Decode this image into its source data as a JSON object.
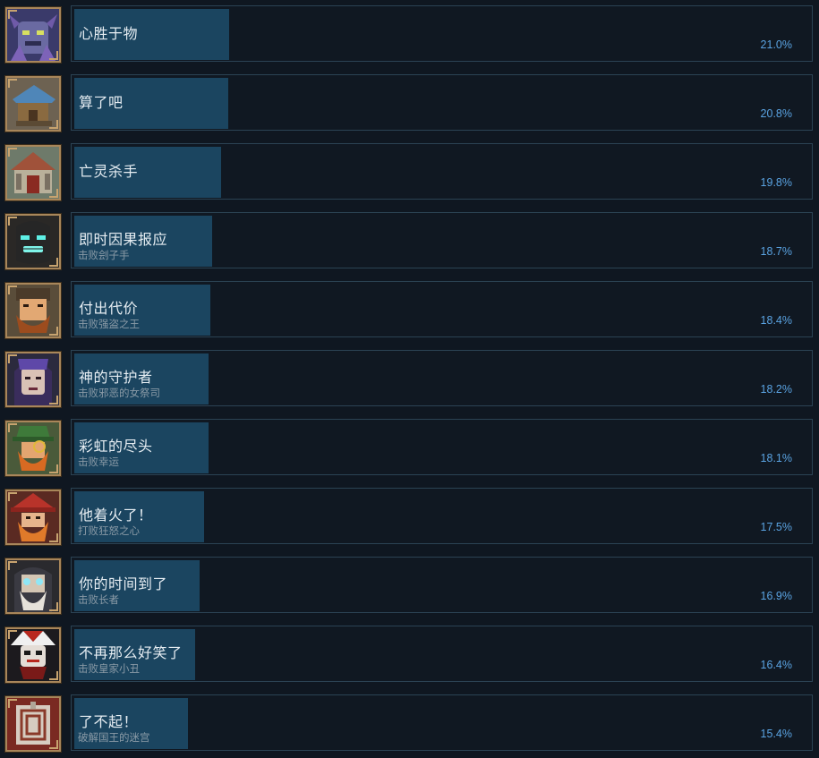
{
  "achievements": [
    {
      "title": "心胜于物",
      "description": "",
      "percent": "21.0%",
      "fill": 0.21,
      "icon": "gargoyle-icon"
    },
    {
      "title": "算了吧",
      "description": "",
      "percent": "20.8%",
      "fill": 0.208,
      "icon": "house-icon"
    },
    {
      "title": "亡灵杀手",
      "description": "",
      "percent": "19.8%",
      "fill": 0.198,
      "icon": "shrine-icon"
    },
    {
      "title": "即时因果报应",
      "description": "击败刽子手",
      "percent": "18.7%",
      "fill": 0.187,
      "icon": "executioner-icon"
    },
    {
      "title": "付出代价",
      "description": "击败强盗之王",
      "percent": "18.4%",
      "fill": 0.184,
      "icon": "bandit-king-icon"
    },
    {
      "title": "神的守护者",
      "description": "击败邪恶的女祭司",
      "percent": "18.2%",
      "fill": 0.182,
      "icon": "priestess-icon"
    },
    {
      "title": "彩虹的尽头",
      "description": "击败幸运",
      "percent": "18.1%",
      "fill": 0.181,
      "icon": "leprechaun-icon"
    },
    {
      "title": "他着火了！",
      "description": "打败狂怒之心",
      "percent": "17.5%",
      "fill": 0.175,
      "icon": "fire-wizard-icon"
    },
    {
      "title": "你的时间到了",
      "description": "击败长者",
      "percent": "16.9%",
      "fill": 0.169,
      "icon": "elder-icon"
    },
    {
      "title": "不再那么好笑了",
      "description": "击败皇家小丑",
      "percent": "16.4%",
      "fill": 0.164,
      "icon": "jester-icon"
    },
    {
      "title": "了不起！",
      "description": "破解国王的迷宫",
      "percent": "15.4%",
      "fill": 0.154,
      "icon": "maze-tower-icon"
    }
  ]
}
